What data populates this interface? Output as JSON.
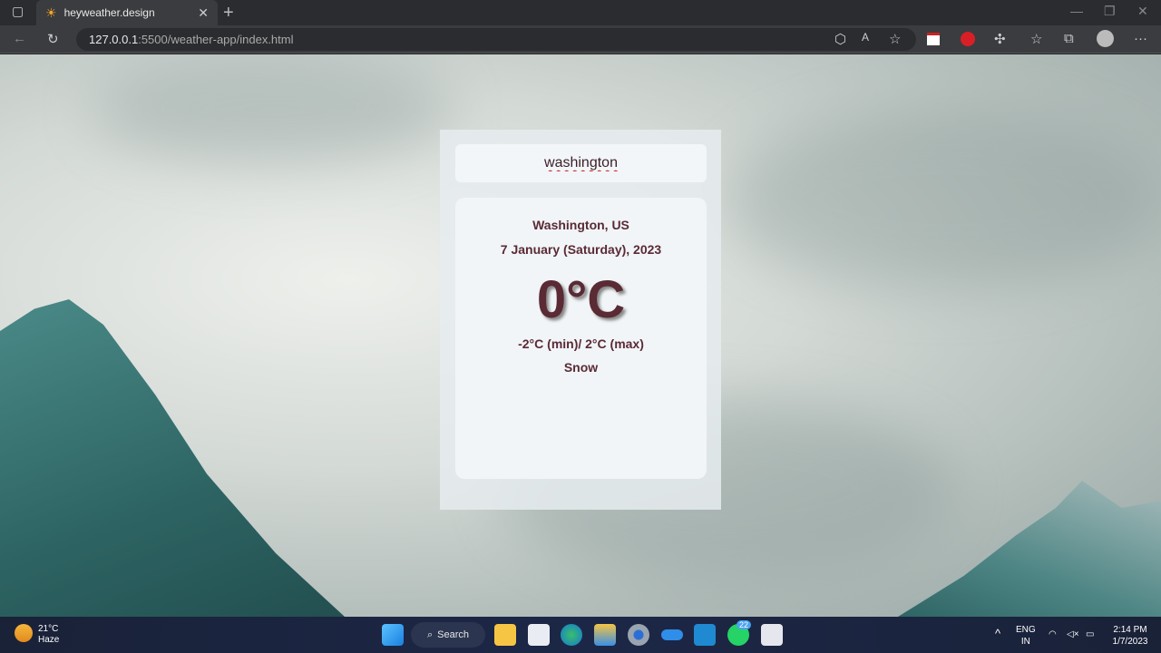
{
  "browser": {
    "tab_title": "heyweather.design",
    "url_host": "127.0.0.1",
    "url_rest": ":5500/weather-app/index.html"
  },
  "app": {
    "search_value": "washington",
    "city": "Washington, US",
    "date": "7 January (Saturday), 2023",
    "temp": "0°C",
    "minmax": "-2°C (min)/ 2°C (max)",
    "description": "Snow"
  },
  "taskbar": {
    "weather_temp": "21°C",
    "weather_desc": "Haze",
    "search_label": "Search",
    "whatsapp_badge": "22",
    "lang_1": "ENG",
    "lang_2": "IN",
    "time": "2:14 PM",
    "date": "1/7/2023"
  },
  "colors": {
    "text": "#5a2a35",
    "taskbar": "#1c2747"
  }
}
